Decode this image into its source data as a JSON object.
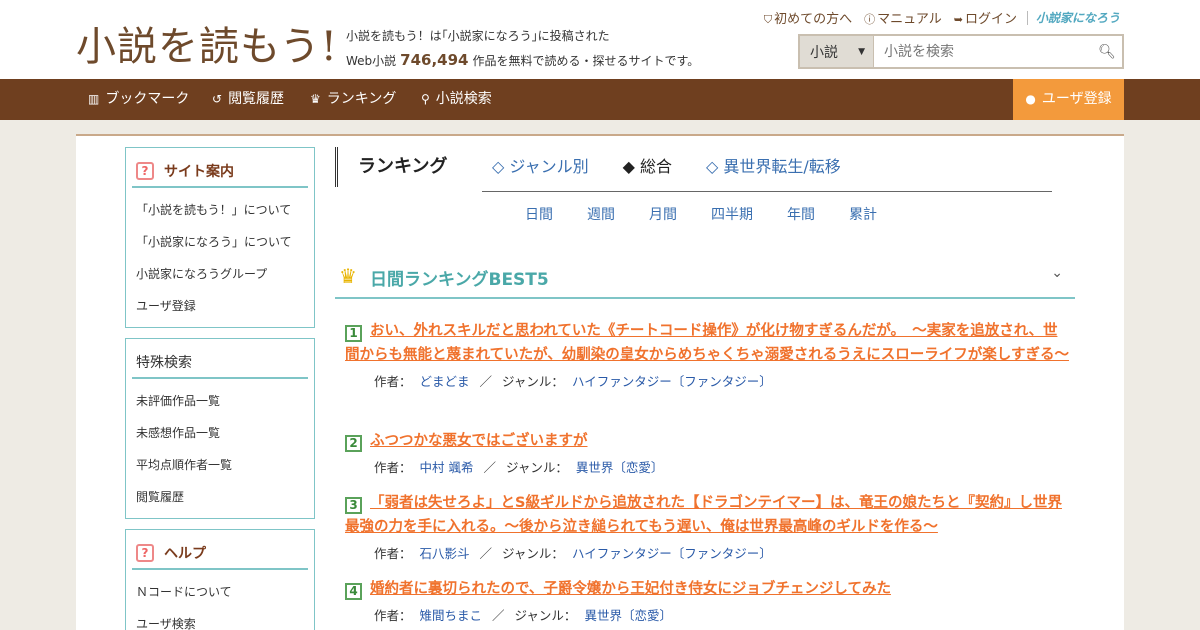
{
  "header": {
    "logo": "小説を読もう!",
    "tagline_line1": "小説を読もう！は｢小説家になろう｣に投稿された",
    "tagline_prefix": "Web小説",
    "work_count": "746,494",
    "tagline_suffix": "作品を無料で読める・探せるサイトです。",
    "links": [
      {
        "label": "初めての方へ"
      },
      {
        "label": "マニュアル"
      },
      {
        "label": "ログイン"
      }
    ],
    "narou_logo": "小説家になろう",
    "search": {
      "category": "小説",
      "placeholder": "小説を検索"
    }
  },
  "nav": {
    "items": [
      {
        "label": "ブックマーク"
      },
      {
        "label": "閲覧履歴"
      },
      {
        "label": "ランキング"
      },
      {
        "label": "小説検索"
      }
    ],
    "register": "ユーザ登録"
  },
  "sidebar": {
    "site": {
      "title": "サイト案内",
      "items": [
        "「小説を読もう！」について",
        "「小説家になろう」について",
        "小説家になろうグループ",
        "ユーザ登録"
      ]
    },
    "special": {
      "title": "特殊検索",
      "items": [
        "未評価作品一覧",
        "未感想作品一覧",
        "平均点順作者一覧",
        "閲覧履歴"
      ]
    },
    "help": {
      "title": "ヘルプ",
      "items": [
        "Ｎコードについて",
        "ユーザ検索"
      ]
    }
  },
  "main": {
    "title": "ランキング",
    "tabs": [
      "◇ ジャンル別",
      "◆ 総合",
      "◇ 異世界転生/転移"
    ],
    "periods": [
      "日間",
      "週間",
      "月間",
      "四半期",
      "年間",
      "累計"
    ],
    "section_title": "日間ランキングBEST5",
    "author_label": "作者：",
    "genre_label": "ジャンル：",
    "entries": [
      {
        "rank": "1",
        "title": "おい、外れスキルだと思われていた《チートコード操作》が化け物すぎるんだが。　～実家を追放され、世間からも無能と蔑まれていたが、幼馴染の皇女からめちゃくちゃ溺愛されるうえにスローライフが楽しすぎる～",
        "author": "どまどま",
        "genre": "ハイファンタジー〔ファンタジー〕"
      },
      {
        "rank": "2",
        "title": "ふつつかな悪女ではございますが",
        "author": "中村 颯希",
        "genre": "異世界〔恋愛〕"
      },
      {
        "rank": "3",
        "title": "「弱者は失せろよ」とS級ギルドから追放された【ドラゴンテイマー】は、竜王の娘たちと『契約』し世界最強の力を手に入れる。～後から泣き縋られてもう遅い、俺は世界最高峰のギルドを作る～",
        "author": "石八影斗",
        "genre": "ハイファンタジー〔ファンタジー〕"
      },
      {
        "rank": "4",
        "title": "婚約者に裏切られたので、子爵令嬢から王妃付き侍女にジョブチェンジしてみた",
        "author": "雉間ちまこ",
        "genre": "異世界〔恋愛〕"
      }
    ]
  }
}
